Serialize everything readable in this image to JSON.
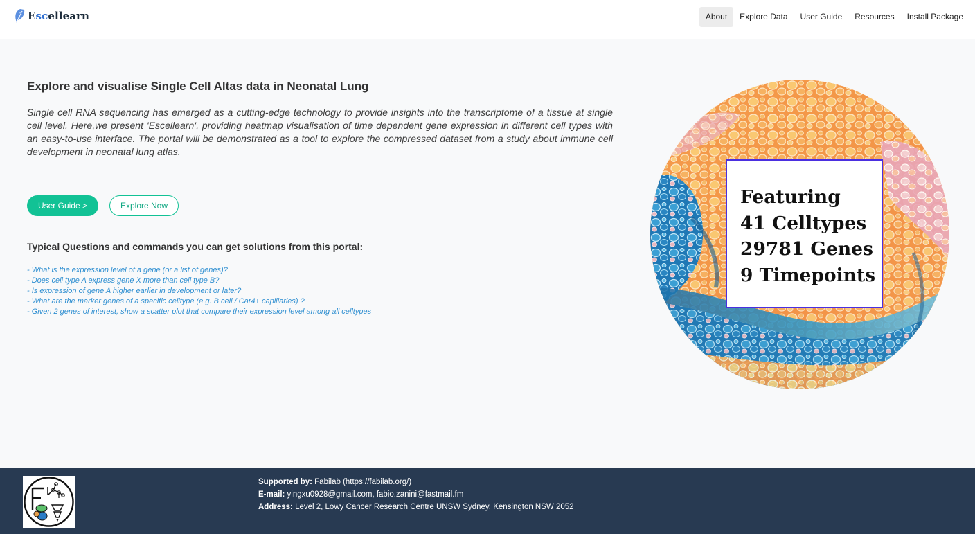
{
  "brand": {
    "name_part1": "E",
    "name_highlight": "sc",
    "name_part2": "ellearn"
  },
  "nav": {
    "items": [
      {
        "label": "About",
        "active": true
      },
      {
        "label": "Explore Data",
        "active": false
      },
      {
        "label": "User Guide",
        "active": false
      },
      {
        "label": "Resources",
        "active": false
      },
      {
        "label": "Install Package",
        "active": false
      }
    ]
  },
  "main": {
    "title": "Explore and visualise Single Cell Altas data in Neonatal Lung",
    "intro": "Single cell RNA sequencing has emerged as a cutting-edge technology to provide insights into the transcriptome of a tissue at single cell level. Here,we present 'Escellearn', providing heatmap visualisation of time dependent gene expression in different cell types with an easy-to-use interface. The portal will be demonstrated as a tool to explore the compressed dataset from a study about immune cell development in neonatal lung atlas.",
    "buttons": {
      "user_guide": "User Guide >",
      "explore_now": "Explore Now"
    },
    "questions_title": "Typical Questions and commands you can get solutions from this portal:",
    "questions": [
      "- What is the expression level of a gene (or a list of genes)?",
      "- Does cell type A express gene X more than cell type B?",
      "- Is expression of gene A higher earlier in development or later?",
      "- What are the marker genes of a specific celltype (e.g. B cell / Car4+ capillaries) ?",
      "- Given 2 genes of interest, show a scatter plot that compare their expression level among all celltypes"
    ]
  },
  "feature": {
    "lines": [
      "Featuring",
      "41 Celltypes",
      "29781 Genes",
      "9 Timepoints"
    ]
  },
  "footer": {
    "supported_label": "Supported by:",
    "supported_value": "Fabilab (https://fabilab.org/)",
    "email_label": "E-mail:",
    "email_value": "yingxu0928@gmail.com, fabio.zanini@fastmail.fm",
    "address_label": "Address:",
    "address_value": "Level 2, Lowy Cancer Research Centre UNSW Sydney, Kensington NSW 2052"
  },
  "colors": {
    "accent": "#12c295",
    "question_text": "#2f8fd1",
    "footer_bg": "#283a52",
    "feature_box_border": "#4b2fe0"
  },
  "icons": {
    "brand_logo": "blue-feather-icon",
    "footer_logo": "fabilab-logo"
  }
}
